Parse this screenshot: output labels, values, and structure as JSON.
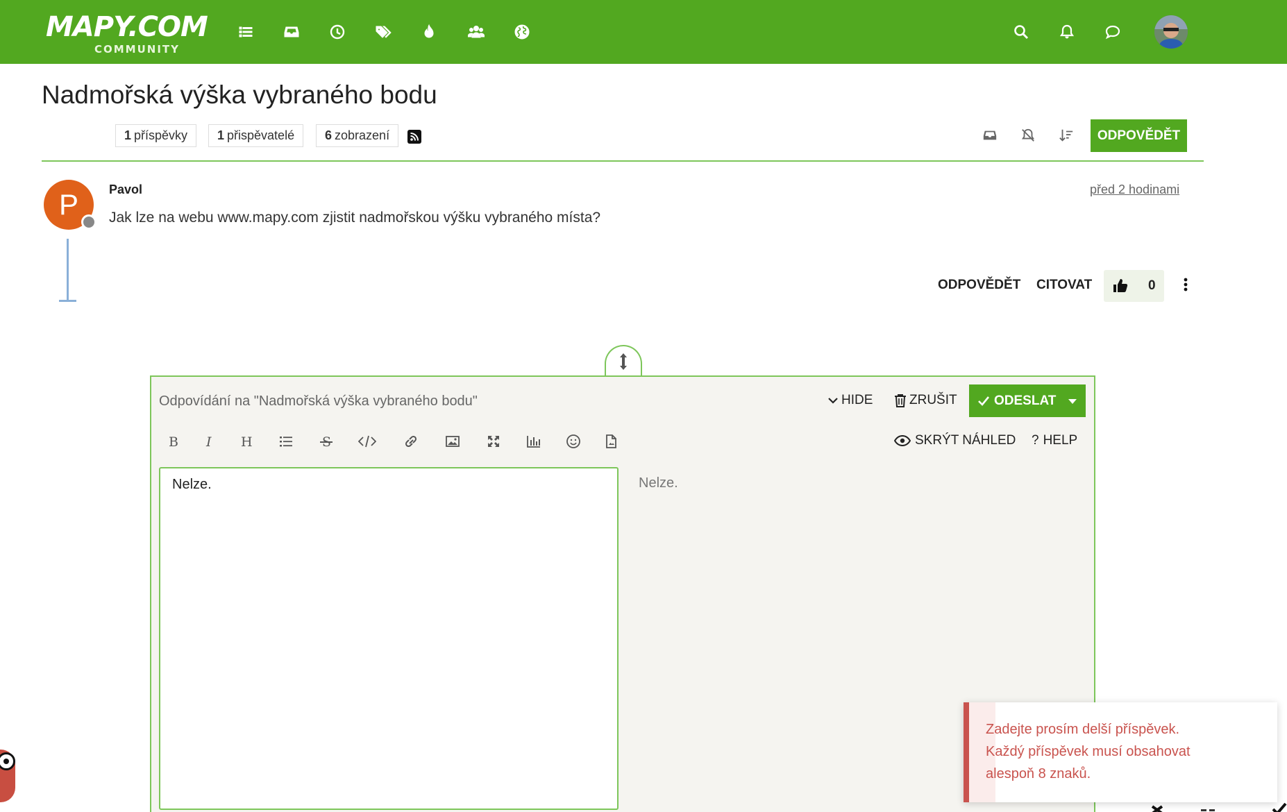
{
  "brand": {
    "logo_main": "MAPY.COM",
    "logo_sub": "COMMUNITY"
  },
  "colors": {
    "brand_green": "#52a820",
    "avatar_orange": "#e0611a",
    "error_red": "#c9534e"
  },
  "nav": {
    "icons": [
      "list-icon",
      "inbox-icon",
      "clock-icon",
      "tags-icon",
      "fire-icon",
      "users-icon",
      "globe-icon"
    ],
    "right_icons": [
      "search-icon",
      "bell-icon",
      "chat-icon"
    ]
  },
  "topic": {
    "title": "Nadmořská výška vybraného bodu",
    "stats": [
      {
        "count": "1",
        "label": "příspěvky"
      },
      {
        "count": "1",
        "label": "přispěvatelé"
      },
      {
        "count": "6",
        "label": "zobrazení"
      }
    ],
    "reply_button": "ODPOVĚDĚT"
  },
  "post": {
    "avatar_letter": "P",
    "author": "Pavol",
    "time": "před 2 hodinami",
    "body": "Jak lze na webu www.mapy.com zjistit nadmořskou výšku vybraného místa?",
    "reply": "ODPOVĚDĚT",
    "quote": "CITOVAT",
    "likes": "0"
  },
  "composer": {
    "replying_to": "Odpovídání na \"Nadmořská výška vybraného bodu\"",
    "hide": "HIDE",
    "cancel": "ZRUŠIT",
    "send": "ODESLAT",
    "toolbar": [
      "bold-icon",
      "italic-icon",
      "heading-icon",
      "list-icon",
      "strikethrough-icon",
      "code-icon",
      "link-icon",
      "image-icon",
      "fullscreen-icon",
      "chart-icon",
      "emoji-icon",
      "file-icon"
    ],
    "toggle_preview": "SKRÝT NÁHLED",
    "help": "HELP",
    "editor_text": "Nelze.",
    "preview_text": "Nelze."
  },
  "toast": {
    "line1": "Zadejte prosím delší příspěvek.",
    "line2": "Každý příspěvek musí obsahovat",
    "line3": "alespoň 8 znaků."
  }
}
